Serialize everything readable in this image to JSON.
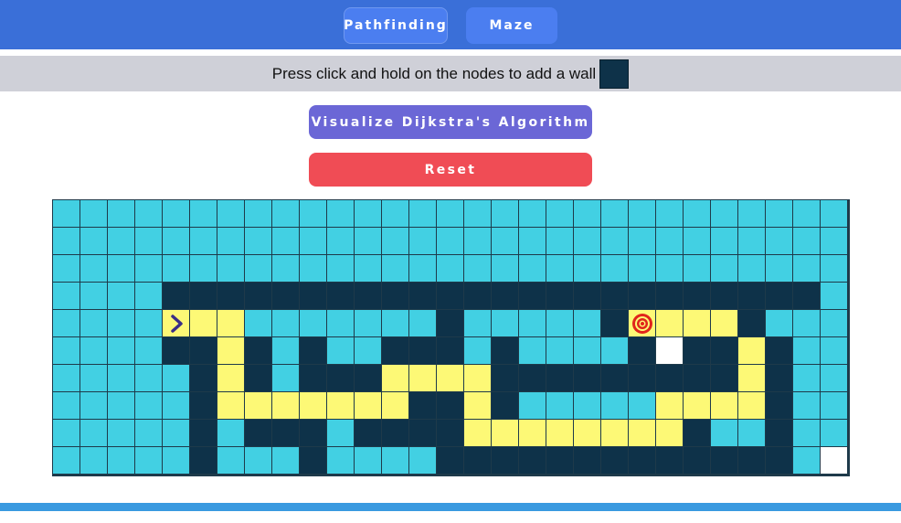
{
  "nav": {
    "pathfinding_label": "Pathfinding",
    "maze_label": "Maze"
  },
  "instruction": {
    "text": "Press click and hold on the nodes to add a wall"
  },
  "actions": {
    "visualize_label": "Visualize Dijkstra's Algorithm",
    "reset_label": "Reset"
  },
  "colors": {
    "header": "#3a6fd8",
    "open_node": "#42d0e3",
    "wall_node": "#0e3249",
    "path_node": "#fdf976",
    "unvisited_node": "#ffffff",
    "visualize_button": "#6b67d6",
    "reset_button": "#f04c55"
  },
  "grid": {
    "legend": {
      "O": "open",
      "W": "wall",
      "P": "path",
      "E": "unvisited",
      "S": "start",
      "T": "target"
    },
    "start_icon": "chevron-right-icon",
    "target_icon": "target-icon",
    "rows": [
      "OOOOOOOOOOOOOOOOOOOOOOOOOOOOO",
      "OOOOOOOOOOOOOOOOOOOOOOOOOOOOO",
      "OOOOOOOOOOOOOOOOOOOOOOOOOOOOO",
      "OOOOWWWWWWWWWWWWWWWWWWWWWWWWOO",
      "OOOOSPPOOOOOOOWOOOOOWTPPPWOO",
      "OOOOWWPWOWOOWWWOWOOOOWEWWPWOO",
      "OOOOOWPWOWWWPPPPWWWWWWWWWPWOO",
      "OOOOOWPPPPPPPWWPWOOOOOPPPPWOO",
      "OOOOOWOWWWOWWWWPPPPPPPPWOOWOO",
      "OOOOOWOOOWOOOOWWWWWWWWWWWWWOE"
    ]
  }
}
